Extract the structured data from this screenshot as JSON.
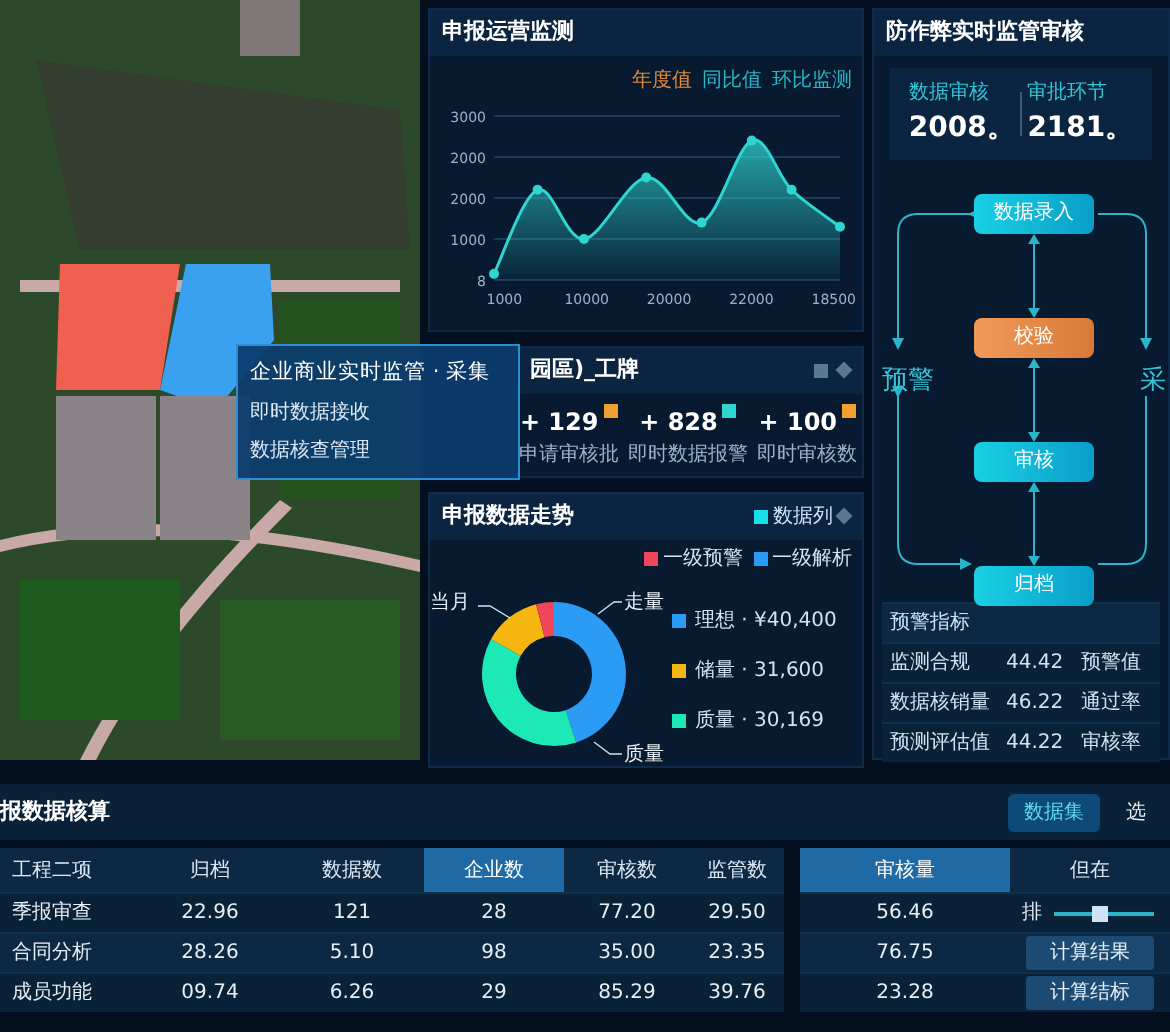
{
  "map_popup": {
    "title": "企业商业实时监管 · 采集",
    "rows": [
      "即时数据接收",
      "数据核查管理"
    ]
  },
  "trend_panel": {
    "title": "申报运营监测",
    "legend": [
      {
        "label": "年度值",
        "color": "#e08a3c"
      },
      {
        "label": "同比值",
        "color": "#2ab5c8"
      },
      {
        "label": "环比监测",
        "color": "#2ab5c8"
      }
    ],
    "x_labels": [
      "1000",
      "10000",
      "20000",
      "22000",
      "18500"
    ],
    "y_labels": [
      "3000",
      "2000",
      "2000",
      "1000",
      "8"
    ]
  },
  "stats_panel": {
    "title": "园區)_工牌",
    "items": [
      {
        "value": "+ 129",
        "label": "申请审核批",
        "color": "#f0a030"
      },
      {
        "value": "+ 828",
        "label": "即时数据报警",
        "color": "#2fd6d0"
      },
      {
        "value": "+ 100",
        "label": "即时审核数",
        "color": "#f0a030"
      }
    ]
  },
  "donut_panel": {
    "title": "申报数据走势",
    "control_label": "数据列",
    "legend": [
      {
        "label": "一级预警",
        "color": "#f0455a"
      },
      {
        "label": "一级解析",
        "color": "#2b9bf4"
      }
    ],
    "callouts": [
      "当月",
      "走量",
      "质量"
    ],
    "breakdown": [
      {
        "label": "理想 · ¥40,400",
        "color": "#2b9bf4"
      },
      {
        "label": "储量 · 31,600",
        "color": "#f5b70f"
      },
      {
        "label": "质量 · 30,169",
        "color": "#1de9b6"
      }
    ]
  },
  "audit_panel": {
    "title": "防作弊实时监管审核",
    "stats": [
      {
        "label": "数据审核",
        "value": "2008。"
      },
      {
        "label": "审批环节",
        "value": "2181。"
      }
    ],
    "flow_steps": [
      {
        "label": "数据录入",
        "kind": "step"
      },
      {
        "label": "校验",
        "kind": "check"
      },
      {
        "label": "审核",
        "kind": "step"
      },
      {
        "label": "归档",
        "kind": "step"
      }
    ],
    "side_labels": [
      "预警",
      "采"
    ],
    "table": {
      "title": "预警指标",
      "rows": [
        [
          "监测合规",
          "44.42",
          "预警值"
        ],
        [
          "数据核销量",
          "46.22",
          "通过率"
        ],
        [
          "预测评估值",
          "44.22",
          "审核率"
        ]
      ]
    }
  },
  "accounting": {
    "title": "报数据核算",
    "buttons": [
      {
        "label": "数据集",
        "selected": true
      },
      {
        "label": "选",
        "selected": false
      }
    ],
    "main_table": {
      "columns": [
        {
          "label": "工程二项",
          "selected": false
        },
        {
          "label": "归档",
          "selected": false
        },
        {
          "label": "数据数",
          "selected": false
        },
        {
          "label": "企业数",
          "selected": true
        },
        {
          "label": "审核数",
          "selected": false
        },
        {
          "label": "监管数",
          "selected": false
        }
      ],
      "rows": [
        [
          "季报审查",
          "22.96",
          "121",
          "28",
          "77.20",
          "29.50"
        ],
        [
          "合同分析",
          "28.26",
          "5.10",
          "98",
          "35.00",
          "23.35"
        ],
        [
          "成员功能",
          "09.74",
          "6.26",
          "29",
          "85.29",
          "39.76"
        ]
      ]
    },
    "side_table": {
      "columns": [
        {
          "label": "审核量",
          "selected": true
        },
        {
          "label": "但在",
          "selected": false
        }
      ],
      "rows": [
        {
          "value": "56.46",
          "kind": "slider",
          "label": "排",
          "level": 0.45
        },
        {
          "value": "76.75",
          "kind": "button",
          "label": "计算结果"
        },
        {
          "value": "23.28",
          "kind": "button",
          "label": "计算结标"
        }
      ]
    }
  }
}
